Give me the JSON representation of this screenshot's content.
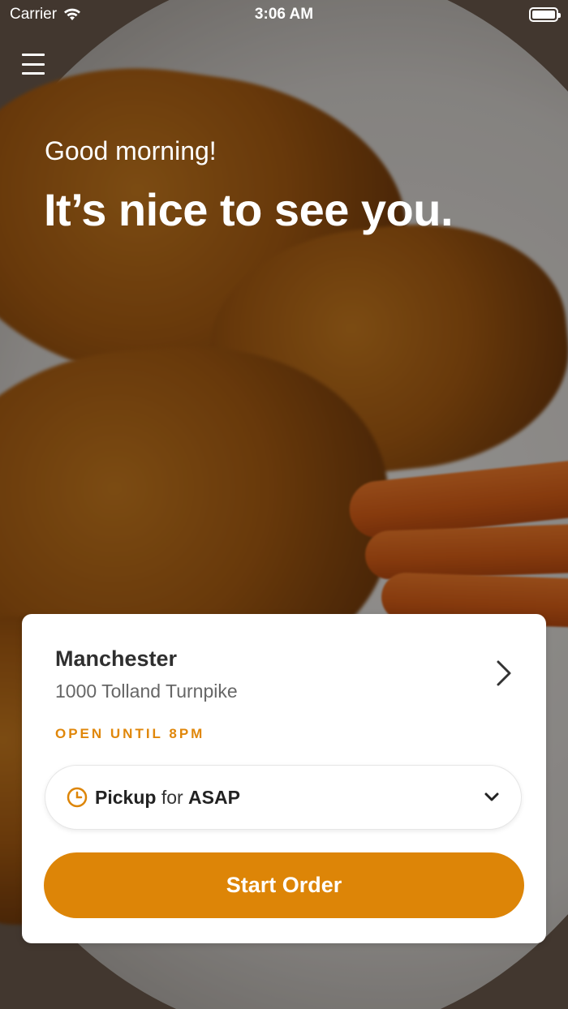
{
  "status_bar": {
    "carrier": "Carrier",
    "time": "3:06 AM"
  },
  "hero": {
    "greeting": "Good morning!",
    "headline": "It’s nice to see you."
  },
  "location_card": {
    "name": "Manchester",
    "address": "1000 Tolland Turnpike",
    "hours_status": "OPEN UNTIL 8PM",
    "order_mode": "Pickup",
    "order_connector": "for",
    "order_time": "ASAP",
    "start_button_label": "Start Order"
  },
  "colors": {
    "accent": "#dd8507",
    "text_dark": "#2f2f2f",
    "text_muted": "#666666"
  },
  "icons": {
    "menu": "hamburger-menu-icon",
    "wifi": "wifi-icon",
    "battery": "battery-icon",
    "chevron_right": "chevron-right-icon",
    "clock": "clock-icon",
    "chevron_down": "chevron-down-icon"
  }
}
